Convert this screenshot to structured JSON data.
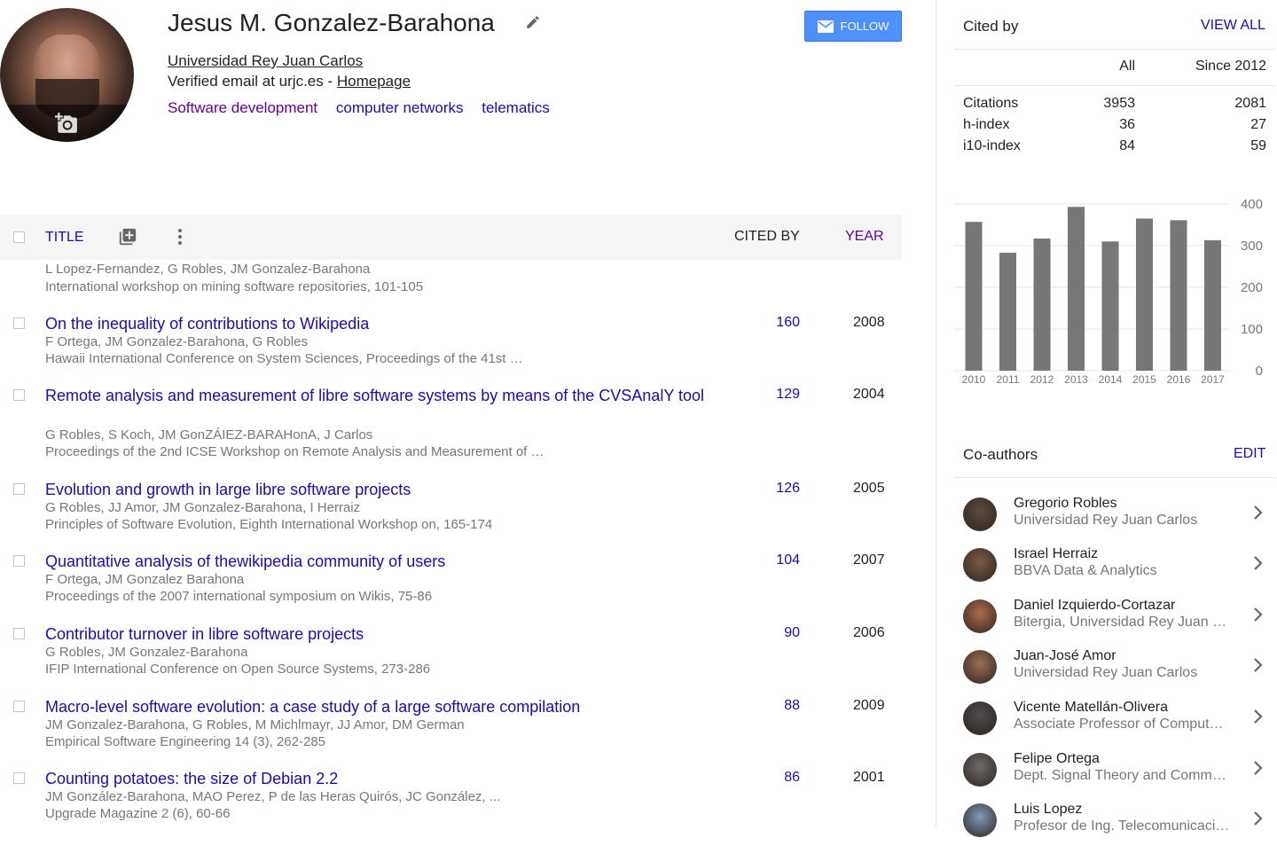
{
  "profile": {
    "name": "Jesus M. Gonzalez-Barahona",
    "affiliation": "Universidad Rey Juan Carlos",
    "email_prefix": "Verified email at urjc.es - ",
    "homepage_label": "Homepage",
    "interests": [
      "Software development",
      "computer networks",
      "telematics"
    ],
    "follow_label": "FOLLOW"
  },
  "table": {
    "title_label": "TITLE",
    "cited_by_label": "CITED BY",
    "year_label": "YEAR"
  },
  "articles": [
    {
      "title": "",
      "authors": "L Lopez-Fernandez, G Robles, JM Gonzalez-Barahona",
      "venue": "International workshop on mining software repositories, 101-105",
      "cited": "",
      "year": ""
    },
    {
      "title": "On the inequality of contributions to Wikipedia",
      "authors": "F Ortega, JM Gonzalez-Barahona, G Robles",
      "venue": "Hawaii International Conference on System Sciences, Proceedings of the 41st …",
      "cited": "160",
      "year": "2008"
    },
    {
      "title": "Remote analysis and measurement of libre software systems by means of the CVSAnalY tool",
      "authors": "G Robles, S Koch, JM GonZÁIEZ-BARAHonA, J Carlos",
      "venue": "Proceedings of the 2nd ICSE Workshop on Remote Analysis and Measurement of …",
      "cited": "129",
      "year": "2004"
    },
    {
      "title": "Evolution and growth in large libre software projects",
      "authors": "G Robles, JJ Amor, JM Gonzalez-Barahona, I Herraiz",
      "venue": "Principles of Software Evolution, Eighth International Workshop on, 165-174",
      "cited": "126",
      "year": "2005"
    },
    {
      "title": "Quantitative analysis of thewikipedia community of users",
      "authors": "F Ortega, JM Gonzalez Barahona",
      "venue": "Proceedings of the 2007 international symposium on Wikis, 75-86",
      "cited": "104",
      "year": "2007"
    },
    {
      "title": "Contributor turnover in libre software projects",
      "authors": "G Robles, JM Gonzalez-Barahona",
      "venue": "IFIP International Conference on Open Source Systems, 273-286",
      "cited": "90",
      "year": "2006"
    },
    {
      "title": "Macro-level software evolution: a case study of a large software compilation",
      "authors": "JM Gonzalez-Barahona, G Robles, M Michlmayr, JJ Amor, DM German",
      "venue": "Empirical Software Engineering 14 (3), 262-285",
      "cited": "88",
      "year": "2009"
    },
    {
      "title": "Counting potatoes: the size of Debian 2.2",
      "authors": "JM González-Barahona, MAO Perez, P de las Heras Quirós, JC González, ...",
      "venue": "Upgrade Magazine 2 (6), 60-66",
      "cited": "86",
      "year": "2001"
    }
  ],
  "cited_by": {
    "heading": "Cited by",
    "view_all": "VIEW ALL",
    "col_all": "All",
    "col_since": "Since 2012",
    "rows": [
      {
        "label": "Citations",
        "all": "3953",
        "since": "2081"
      },
      {
        "label": "h-index",
        "all": "36",
        "since": "27"
      },
      {
        "label": "i10-index",
        "all": "84",
        "since": "59"
      }
    ]
  },
  "chart_data": {
    "type": "bar",
    "categories": [
      "2010",
      "2011",
      "2012",
      "2013",
      "2014",
      "2015",
      "2016",
      "2017"
    ],
    "values": [
      357,
      283,
      317,
      393,
      310,
      365,
      361,
      313
    ],
    "ylim": [
      0,
      400
    ],
    "yticks": [
      0,
      100,
      200,
      300,
      400
    ],
    "bar_color": "#777777",
    "grid": true
  },
  "coauthors": {
    "heading": "Co-authors",
    "edit_label": "EDIT",
    "items": [
      {
        "name": "Gregorio Robles",
        "affiliation": "Universidad Rey Juan Carlos",
        "color": "#5b4a3f"
      },
      {
        "name": "Israel Herraiz",
        "affiliation": "BBVA Data & Analytics",
        "color": "#7a5a43"
      },
      {
        "name": "Daniel Izquierdo-Cortazar",
        "affiliation": "Bitergia, Universidad Rey Juan …",
        "color": "#b06a4a"
      },
      {
        "name": "Juan-José Amor",
        "affiliation": "Universidad Rey Juan Carlos",
        "color": "#9b6e55"
      },
      {
        "name": "Vicente Matellán-Olivera",
        "affiliation": "Associate Professor of Compute…",
        "color": "#4c4c4c"
      },
      {
        "name": "Felipe Ortega",
        "affiliation": "Dept. Signal Theory and Comm…",
        "color": "#6f6a68"
      },
      {
        "name": "Luis Lopez",
        "affiliation": "Profesor de Ing. Telecomunicaci…",
        "color": "#7f98b8"
      }
    ]
  },
  "colors": {
    "link": "#1a0dab",
    "visited": "#660099",
    "follow_button": "#4d90fe"
  }
}
